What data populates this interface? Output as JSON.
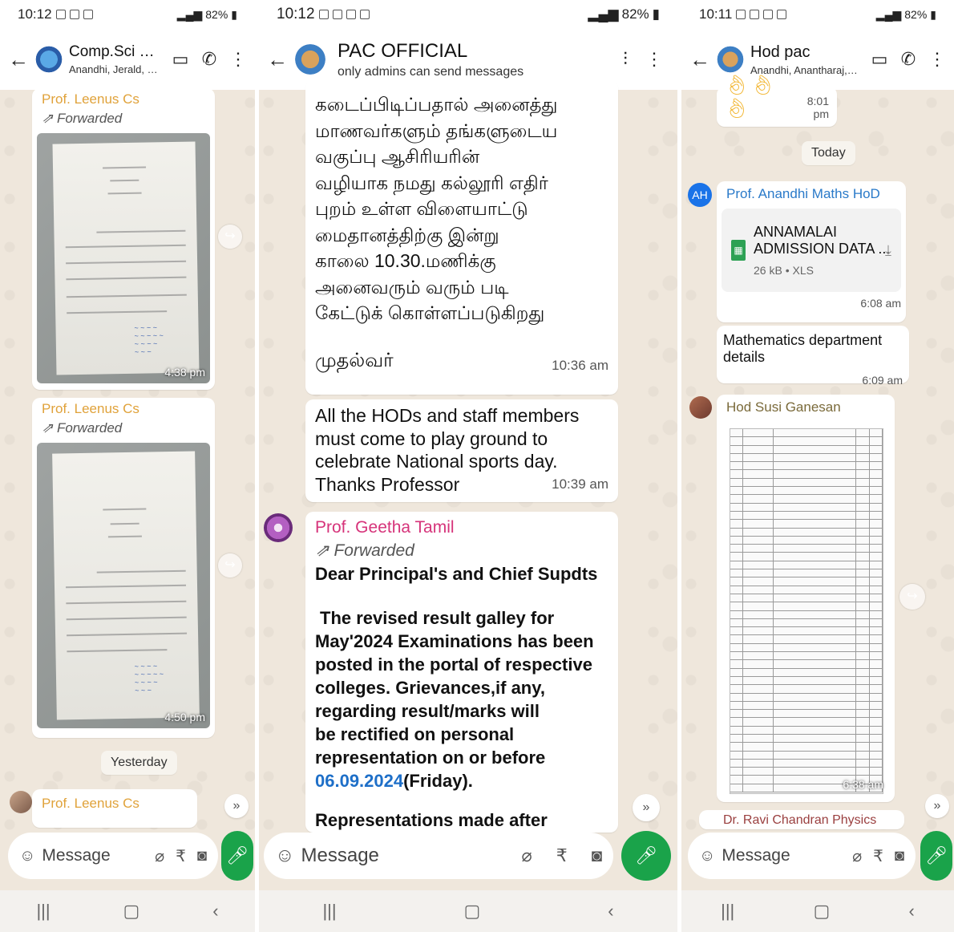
{
  "screen1": {
    "status": {
      "time": "10:12",
      "battery": "82%"
    },
    "header": {
      "title": "Comp.Sci Dept, PAC",
      "subtitle": "Anandhi, Jerald, Jothiammal,..."
    },
    "messages": [
      {
        "sender": "Prof. Leenus Cs",
        "forwarded": "Forwarded",
        "time": "4:38 pm"
      },
      {
        "sender": "Prof. Leenus Cs",
        "forwarded": "Forwarded",
        "time": "4:50 pm"
      }
    ],
    "date_pill": "Yesterday",
    "last_sender": "Prof. Leenus Cs",
    "input_placeholder": "Message"
  },
  "screen2": {
    "status": {
      "time": "10:12",
      "battery": "82%"
    },
    "header": {
      "title": "PAC OFFICIAL",
      "subtitle": "only admins can send messages"
    },
    "msg1": {
      "lines": [
        "கடைப்பிடிப்பதால் அனைத்து",
        "மாணவர்களும் தங்களுடைய",
        "வகுப்பு ஆசிரியரின்",
        "வழியாக நமது கல்லூரி எதிர்",
        "புறம் உள்ள விளையாட்டு",
        "மைதானத்திற்கு இன்று",
        "காலை 10.30.மணிக்கு",
        "அனைவரும் வரும் படி",
        "கேட்டுக் கொள்ளப்படுகிறது"
      ],
      "signature": "முதல்வர்",
      "time": "10:36 am"
    },
    "msg2": {
      "lines": [
        "All the HODs and staff members",
        "must come to play ground to",
        "celebrate National sports day.",
        "Thanks Professor"
      ],
      "time": "10:39 am"
    },
    "msg3": {
      "sender": "Prof. Geetha Tamil",
      "forwarded": "Forwarded",
      "line1": "Dear Principal's and Chief Supdts",
      "body": [
        "The revised result galley for",
        "May'2024 Examinations has been",
        "posted in the portal of respective",
        "colleges. Grievances,if any,",
        "regarding result/marks will",
        "be rectified on personal",
        "representation on or before"
      ],
      "date_link": "06.09.2024",
      "date_suffix": "(Friday).",
      "cut_line": "Representations made after"
    },
    "input_placeholder": "Message"
  },
  "screen3": {
    "status": {
      "time": "10:11",
      "battery": "82%"
    },
    "header": {
      "title": "Hod pac",
      "subtitle": "Anandhi, Anantharaj, Aruldas..."
    },
    "emoji_time": "8:01 pm",
    "date_pill": "Today",
    "msg1": {
      "avatar": "AH",
      "sender": "Prof. Anandhi Maths HoD",
      "file_name_1": "ANNAMALAI",
      "file_name_2": "ADMISSION DATA ...",
      "file_meta": "26 kB • XLS",
      "time": "6:08 am"
    },
    "msg2": {
      "text": "Mathematics department details",
      "time": "6:09 am"
    },
    "msg3": {
      "sender": "Hod Susi Ganesan",
      "time": "6:38 am"
    },
    "cut_sender": "Dr. Ravi Chandran Physics",
    "input_placeholder": "Message"
  }
}
